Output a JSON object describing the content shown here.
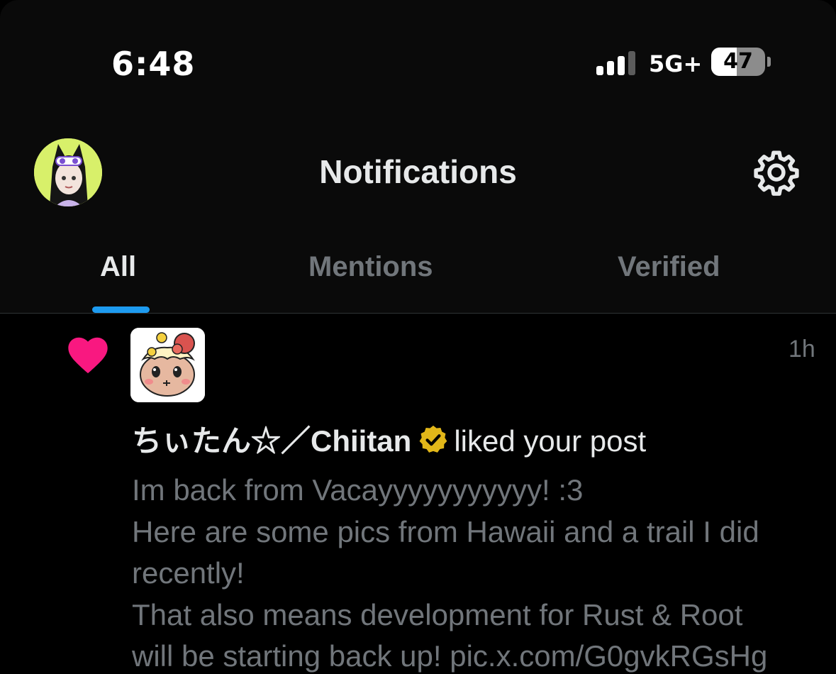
{
  "status_bar": {
    "time": "6:48",
    "network": "5G+",
    "battery_percent": "47",
    "battery_level": 0.47,
    "signal_bars_active": 3,
    "signal_bars_total": 4
  },
  "header": {
    "title": "Notifications",
    "avatar_icon": "profile-avatar",
    "settings_icon": "gear-icon"
  },
  "tabs": [
    {
      "label": "All",
      "active": true
    },
    {
      "label": "Mentions",
      "active": false
    },
    {
      "label": "Verified",
      "active": false
    }
  ],
  "notification": {
    "type_icon": "heart-icon",
    "time": "1h",
    "user_name": "ちぃたん☆／Chiitan",
    "verified_icon": "verified-badge-icon",
    "action": "liked your post",
    "post_lines": [
      "Im back from Vacayyyyyyyyyyy! :3",
      "Here are some pics from Hawaii and a trail I did",
      "recently!",
      "That also means development for Rust & Root",
      "will be starting back up! pic.x.com/G0gvkRGsHg"
    ]
  },
  "colors": {
    "background": "#000000",
    "header_background": "#0a0a0a",
    "primary_text": "#e7e9ea",
    "secondary_text": "#71767b",
    "accent_blue": "#1d9bf0",
    "like_pink": "#f91880",
    "verified_gold": "#e2b719"
  }
}
